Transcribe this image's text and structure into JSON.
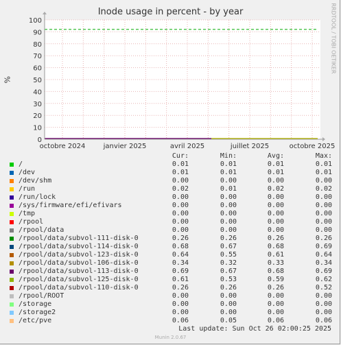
{
  "chart_data": {
    "type": "line",
    "title": "Inode usage in percent - by year",
    "ylabel": "%",
    "ylim": [
      0,
      100
    ],
    "yticks": [
      0,
      10,
      20,
      30,
      40,
      50,
      60,
      70,
      80,
      90,
      100
    ],
    "x_tick_labels": [
      "octobre 2024",
      "janvier 2025",
      "avril 2025",
      "juillet 2025",
      "octobre 2025"
    ],
    "warning_line": 92,
    "grid": true,
    "series_colors": {
      "early": "#6a006a",
      "late": "#b8b800",
      "warning": "#00aa00"
    }
  },
  "watermark": "RRDTOOL / TOBI OETIKER",
  "legend": {
    "headers": [
      "Cur:",
      "Min:",
      "Avg:",
      "Max:"
    ],
    "rows": [
      {
        "name": "/",
        "color": "#00cc00",
        "cur": "0.01",
        "min": "0.01",
        "avg": "0.01",
        "max": "0.01"
      },
      {
        "name": "/dev",
        "color": "#0066b3",
        "cur": "0.01",
        "min": "0.01",
        "avg": "0.01",
        "max": "0.01"
      },
      {
        "name": "/dev/shm",
        "color": "#ff8000",
        "cur": "0.00",
        "min": "0.00",
        "avg": "0.00",
        "max": "0.00"
      },
      {
        "name": "/run",
        "color": "#ffcc00",
        "cur": "0.02",
        "min": "0.01",
        "avg": "0.02",
        "max": "0.02"
      },
      {
        "name": "/run/lock",
        "color": "#330099",
        "cur": "0.00",
        "min": "0.00",
        "avg": "0.00",
        "max": "0.00"
      },
      {
        "name": "/sys/firmware/efi/efivars",
        "color": "#990099",
        "cur": "0.00",
        "min": "0.00",
        "avg": "0.00",
        "max": "0.00"
      },
      {
        "name": "/tmp",
        "color": "#ccff00",
        "cur": "0.00",
        "min": "0.00",
        "avg": "0.00",
        "max": "0.00"
      },
      {
        "name": "/rpool",
        "color": "#ff0000",
        "cur": "0.00",
        "min": "0.00",
        "avg": "0.00",
        "max": "0.00"
      },
      {
        "name": "/rpool/data",
        "color": "#808080",
        "cur": "0.00",
        "min": "0.00",
        "avg": "0.00",
        "max": "0.00"
      },
      {
        "name": "/rpool/data/subvol-111-disk-0",
        "color": "#008f00",
        "cur": "0.26",
        "min": "0.26",
        "avg": "0.26",
        "max": "0.26"
      },
      {
        "name": "/rpool/data/subvol-114-disk-0",
        "color": "#00487d",
        "cur": "0.68",
        "min": "0.67",
        "avg": "0.68",
        "max": "0.69"
      },
      {
        "name": "/rpool/data/subvol-123-disk-0",
        "color": "#b35a00",
        "cur": "0.64",
        "min": "0.55",
        "avg": "0.61",
        "max": "0.64"
      },
      {
        "name": "/rpool/data/subvol-106-disk-0",
        "color": "#b38f00",
        "cur": "0.34",
        "min": "0.32",
        "avg": "0.33",
        "max": "0.34"
      },
      {
        "name": "/rpool/data/subvol-113-disk-0",
        "color": "#6b006b",
        "cur": "0.69",
        "min": "0.67",
        "avg": "0.68",
        "max": "0.69"
      },
      {
        "name": "/rpool/data/subvol-125-disk-0",
        "color": "#8fb300",
        "cur": "0.61",
        "min": "0.53",
        "avg": "0.59",
        "max": "0.62"
      },
      {
        "name": "/rpool/data/subvol-110-disk-0",
        "color": "#b30000",
        "cur": "0.26",
        "min": "0.26",
        "avg": "0.26",
        "max": "0.52"
      },
      {
        "name": "/rpool/ROOT",
        "color": "#bebebe",
        "cur": "0.00",
        "min": "0.00",
        "avg": "0.00",
        "max": "0.00"
      },
      {
        "name": "/storage",
        "color": "#80ff80",
        "cur": "0.00",
        "min": "0.00",
        "avg": "0.00",
        "max": "0.00"
      },
      {
        "name": "/storage2",
        "color": "#80c9ff",
        "cur": "0.00",
        "min": "0.00",
        "avg": "0.00",
        "max": "0.00"
      },
      {
        "name": "/etc/pve",
        "color": "#ffc080",
        "cur": "0.06",
        "min": "0.05",
        "avg": "0.06",
        "max": "0.06"
      }
    ]
  },
  "last_update": "Last update: Sun Oct 26 02:00:25 2025",
  "footer": "Munin 2.0.67"
}
